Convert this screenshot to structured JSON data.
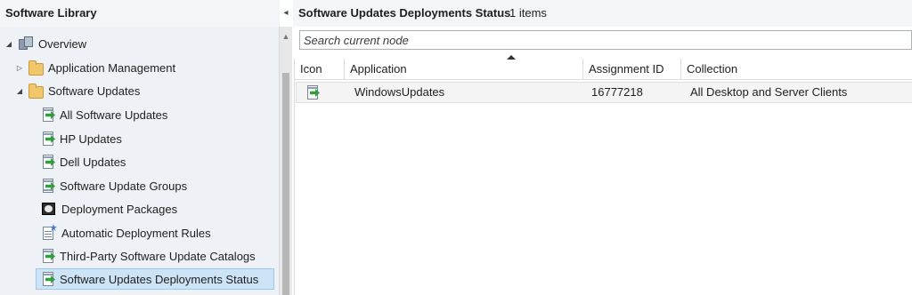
{
  "nav": {
    "title": "Software Library",
    "collapse_glyph": "◂",
    "items": [
      {
        "label": "Overview",
        "icon": "overview-icon",
        "expander": "◢"
      },
      {
        "label": "Application Management",
        "icon": "folder-icon",
        "expander": "▷"
      },
      {
        "label": "Software Updates",
        "icon": "folder-icon",
        "expander": "◢"
      },
      {
        "label": "All Software Updates",
        "icon": "software-update-icon"
      },
      {
        "label": "HP Updates",
        "icon": "software-update-icon"
      },
      {
        "label": "Dell Updates",
        "icon": "software-update-icon"
      },
      {
        "label": "Software Update Groups",
        "icon": "software-update-group-icon"
      },
      {
        "label": "Deployment Packages",
        "icon": "deployment-package-icon"
      },
      {
        "label": "Automatic Deployment Rules",
        "icon": "deployment-rules-icon"
      },
      {
        "label": "Third-Party Software Update Catalogs",
        "icon": "software-update-icon"
      },
      {
        "label": "Software Updates Deployments Status",
        "icon": "software-update-icon",
        "selected": true
      }
    ]
  },
  "content": {
    "title": "Software Updates Deployments Status",
    "count": "1 items",
    "search_placeholder": "Search current node",
    "columns": [
      "Icon",
      "Application",
      "Assignment ID",
      "Collection"
    ],
    "rows": [
      {
        "icon": "software-update-deployment-icon",
        "application": "WindowsUpdates",
        "assignment_id": "16777218",
        "collection": "All Desktop and Server Clients"
      }
    ]
  },
  "colors": {
    "nav_background": "#eef1f6",
    "selection": "#cde4f7",
    "update_arrow": "#2f9e3b",
    "folder": "#f2c76b"
  }
}
